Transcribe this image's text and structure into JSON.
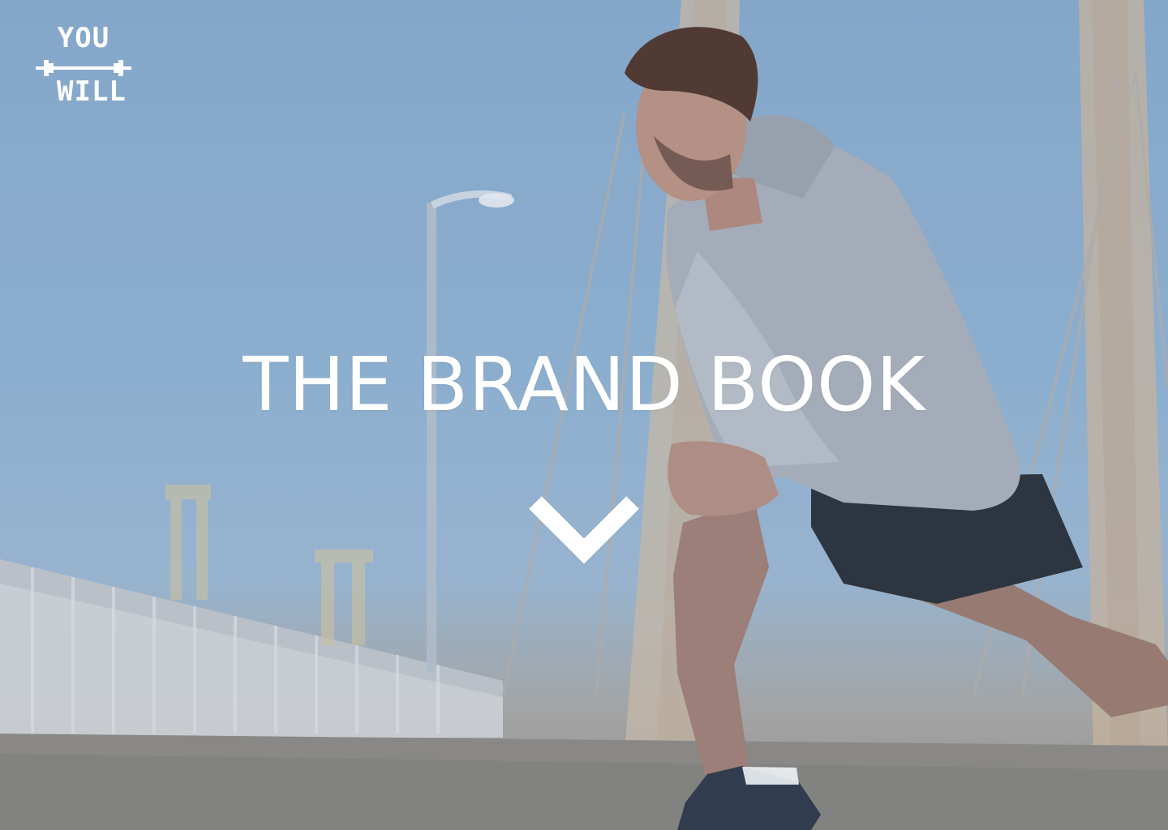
{
  "logo": {
    "top_text": "YOU",
    "bottom_text": "WILL",
    "icon": "dumbbell-icon"
  },
  "hero": {
    "title": "THE BRAND BOOK",
    "scroll_icon": "chevron-down-icon"
  },
  "colors": {
    "text": "#ffffff",
    "sky": "#8fb0cf"
  }
}
